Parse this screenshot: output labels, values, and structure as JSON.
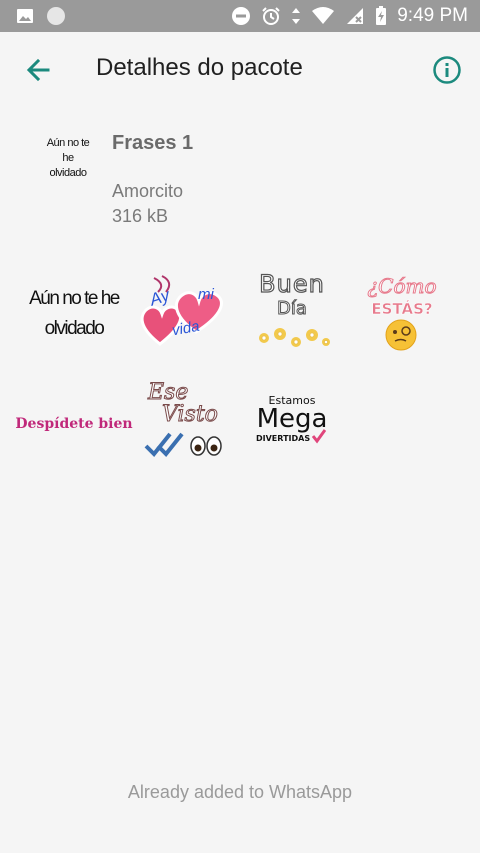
{
  "status_bar": {
    "time": "9:49 PM",
    "icons": [
      "image-icon",
      "circle-icon",
      "dnd-icon",
      "alarm-icon",
      "data-arrows-icon",
      "wifi-icon",
      "signal-icon",
      "battery-charging-icon"
    ]
  },
  "appbar": {
    "title": "Detalhes do pacote",
    "back_icon": "arrow-left-icon",
    "info_icon": "info-icon",
    "accent_color": "#1c8a7e"
  },
  "pack": {
    "tray_text_line1": "Aún no te he",
    "tray_text_line2": "olvidado",
    "name": "Frases 1",
    "author": "Amorcito",
    "size": "316 kB"
  },
  "stickers": [
    {
      "name": "sticker-aun-no-te-he-olvidado",
      "line1": "Aún no te he",
      "line2": "olvidado"
    },
    {
      "name": "sticker-ay-mi-vida",
      "words": [
        "Ay",
        "mi",
        "vida"
      ]
    },
    {
      "name": "sticker-buen-dia",
      "line1": "Buen",
      "line2": "Día"
    },
    {
      "name": "sticker-como-estas",
      "line1": "¿Cómo",
      "line2": "ESTÁS?"
    },
    {
      "name": "sticker-despidete-bien",
      "line1": "Despídete bien"
    },
    {
      "name": "sticker-ese-visto",
      "line1": "Ese",
      "line2": "Visto"
    },
    {
      "name": "sticker-estamos-mega-divertidas",
      "line1": "Estamos",
      "line2": "Mega",
      "line3": "DIVERTIDAS"
    }
  ],
  "footer": {
    "text": "Already added to WhatsApp"
  }
}
